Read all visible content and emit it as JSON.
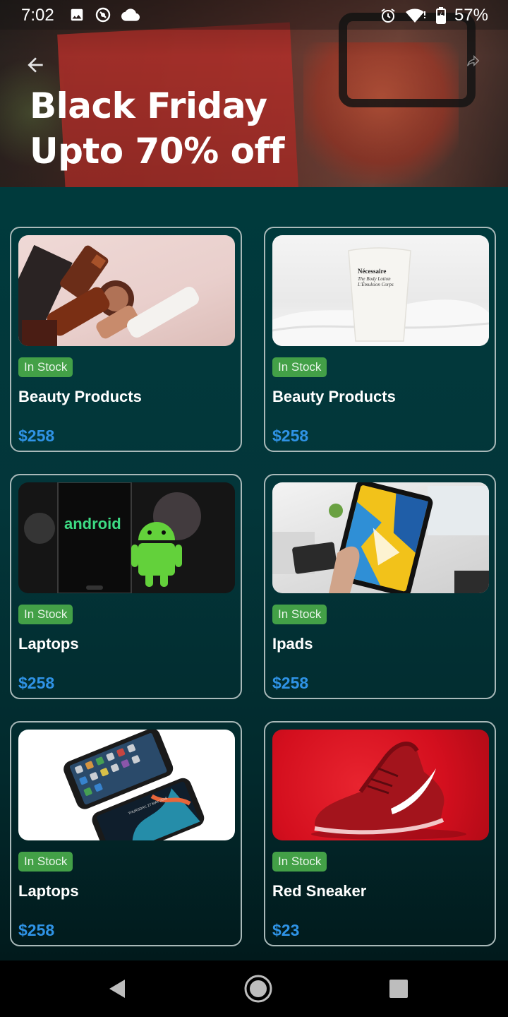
{
  "status_bar": {
    "time": "7:02",
    "battery": "57%",
    "icons_left": [
      "image-icon",
      "sync-icon",
      "cloud-icon"
    ],
    "icons_right": [
      "alarm-icon",
      "wifi-icon",
      "battery-icon"
    ]
  },
  "header": {
    "title_line1": "Black Friday",
    "title_line2": "Upto 70% off",
    "back_icon": "arrow-left-icon",
    "share_icon": "share-icon"
  },
  "products": [
    {
      "title": "Beauty Products",
      "price": "$258",
      "stock": "In Stock",
      "image": "cosmetics-image"
    },
    {
      "title": "Beauty Products",
      "price": "$258",
      "stock": "In Stock",
      "image": "lotion-tube-image"
    },
    {
      "title": "Laptops",
      "price": "$258",
      "stock": "In Stock",
      "image": "android-phone-image"
    },
    {
      "title": "Ipads",
      "price": "$258",
      "stock": "In Stock",
      "image": "ipad-image"
    },
    {
      "title": "Laptops",
      "price": "$258",
      "stock": "In Stock",
      "image": "smartphones-image"
    },
    {
      "title": "Red Sneaker",
      "price": "$23",
      "stock": "In Stock",
      "image": "red-sneaker-image"
    }
  ],
  "thumb_text": {
    "android": "android",
    "lotion_line1": "Nécessaire",
    "lotion_line2": "The Body Lotion",
    "lotion_line3": "L'Émulsion Corps",
    "phone_date": "THURSDAY, 27 MAY 2018"
  },
  "nav_bar": {
    "back": "nav-back-icon",
    "home": "nav-home-icon",
    "recents": "nav-recents-icon"
  },
  "colors": {
    "background_top": "#003a3c",
    "badge": "#43a047",
    "price": "#2f93e6",
    "card_border": "#a9b9b9"
  }
}
